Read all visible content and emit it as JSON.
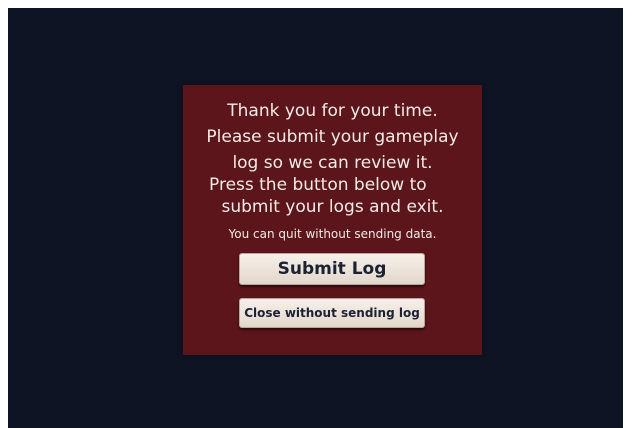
{
  "dialog": {
    "lines": [
      "Thank you for your time.",
      "Please submit your gameplay",
      "log so we can review it.",
      "Press the button below to",
      "submit your logs and exit."
    ],
    "note": "You can quit without sending data.",
    "submit_label": "Submit Log",
    "close_label": "Close without sending log"
  },
  "colors": {
    "background": "#0e1424",
    "dialog": "#5c151b",
    "text": "#f2ebe6",
    "button": "#f6f0ea",
    "button_text": "#1a2233"
  }
}
